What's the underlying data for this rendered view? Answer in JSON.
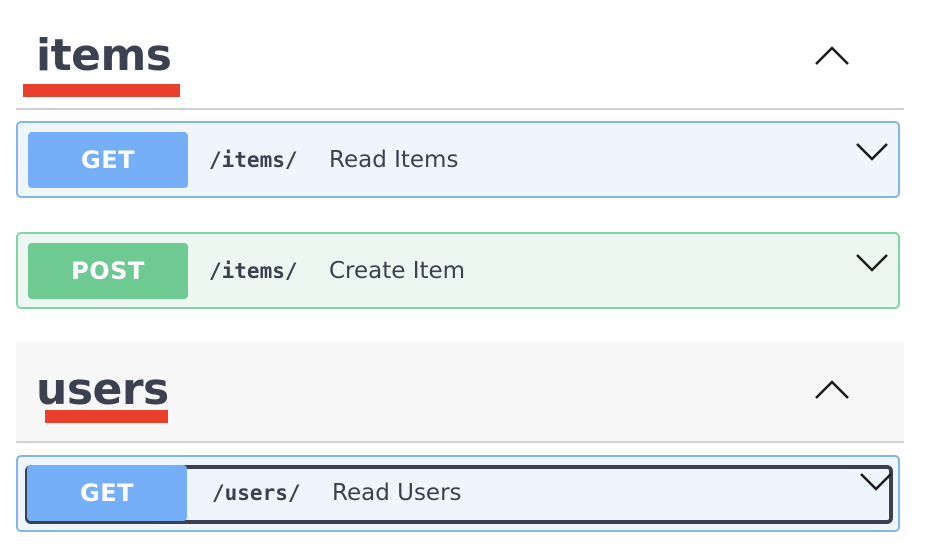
{
  "sections": [
    {
      "title": "items",
      "collapse_icon": "chevron-up-icon",
      "operations": [
        {
          "method": "GET",
          "path": "/items/",
          "summary": "Read Items",
          "color": "#74aff8",
          "expand_icon": "chevron-down-icon"
        },
        {
          "method": "POST",
          "path": "/items/",
          "summary": "Create Item",
          "color": "#6fc993",
          "expand_icon": "chevron-down-icon"
        }
      ]
    },
    {
      "title": "users",
      "collapse_icon": "chevron-up-icon",
      "operations": [
        {
          "method": "GET",
          "path": "/users/",
          "summary": "Read Users",
          "color": "#74aff8",
          "expand_icon": "chevron-down-icon",
          "focused": true
        }
      ]
    }
  ],
  "colors": {
    "title_underline": "#e8402c",
    "get_bg": "#eff5fd",
    "post_bg": "#edf7f1",
    "text": "#3b4151"
  }
}
